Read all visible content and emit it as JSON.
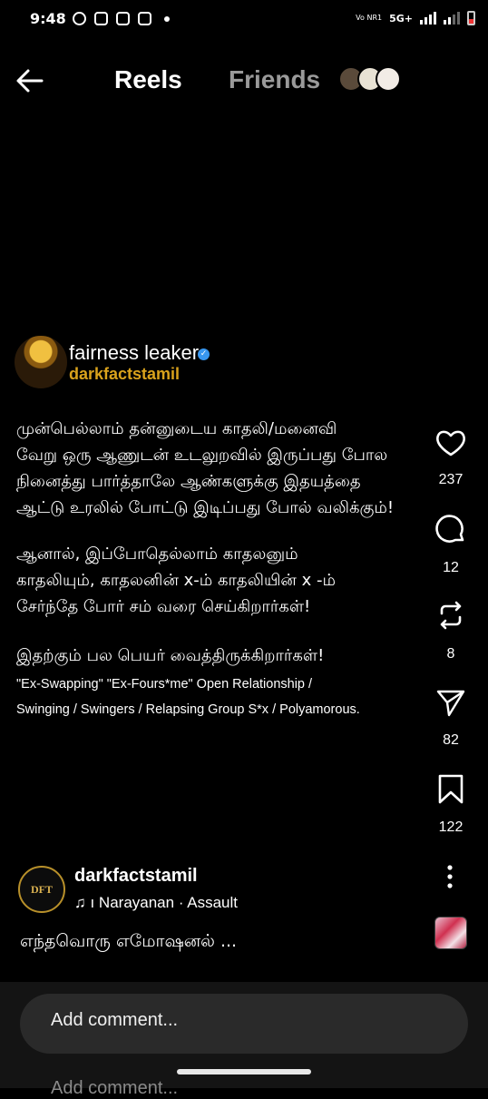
{
  "status_bar": {
    "time": "9:48",
    "network": "Vo NR1",
    "net_type": "5G+"
  },
  "nav": {
    "reels": "Reels",
    "friends": "Friends"
  },
  "overlay": {
    "brand": "fairness leaker",
    "handle": "darkfactstamil",
    "paragraph1": [
      "முன்பெல்லாம் தன்னுடைய காதலி/மனைவி",
      "வேறு ஒரு ஆணுடன் உடலுறவில் இருப்பது போல",
      "நினைத்து பார்த்தாலே ஆண்களுக்கு இதயத்தை",
      "ஆட்டு உரலில் போட்டு இடிப்பது போல் வலிக்கும்!"
    ],
    "paragraph2": [
      "ஆனால், இப்போதெல்லாம் காதலனும்",
      "காதலியும், காதலனின் x-ம் காதலியின் x -ம்",
      "சேர்ந்தே போர் சம் வரை செய்கிறார்கள்!"
    ],
    "paragraph3": "இதற்கும் பல பெயர் வைத்திருக்கிறார்கள்!",
    "english": [
      "\"Ex-Swapping\" \"Ex-Fours*me\" Open Relationship /",
      "Swinging / Swingers / Relapsing Group S*x / Polyamorous."
    ]
  },
  "actions": {
    "likes": "237",
    "comments": "12",
    "reposts": "8",
    "shares": "82",
    "saves": "122"
  },
  "post": {
    "avatar_text": "DFT",
    "author": "darkfactstamil",
    "audio": "ı Narayanan · Assault",
    "caption": "எந்தவொரு எமோஷனல் ..."
  },
  "comment": {
    "placeholder": "Add comment...",
    "peek": "Add comment..."
  }
}
